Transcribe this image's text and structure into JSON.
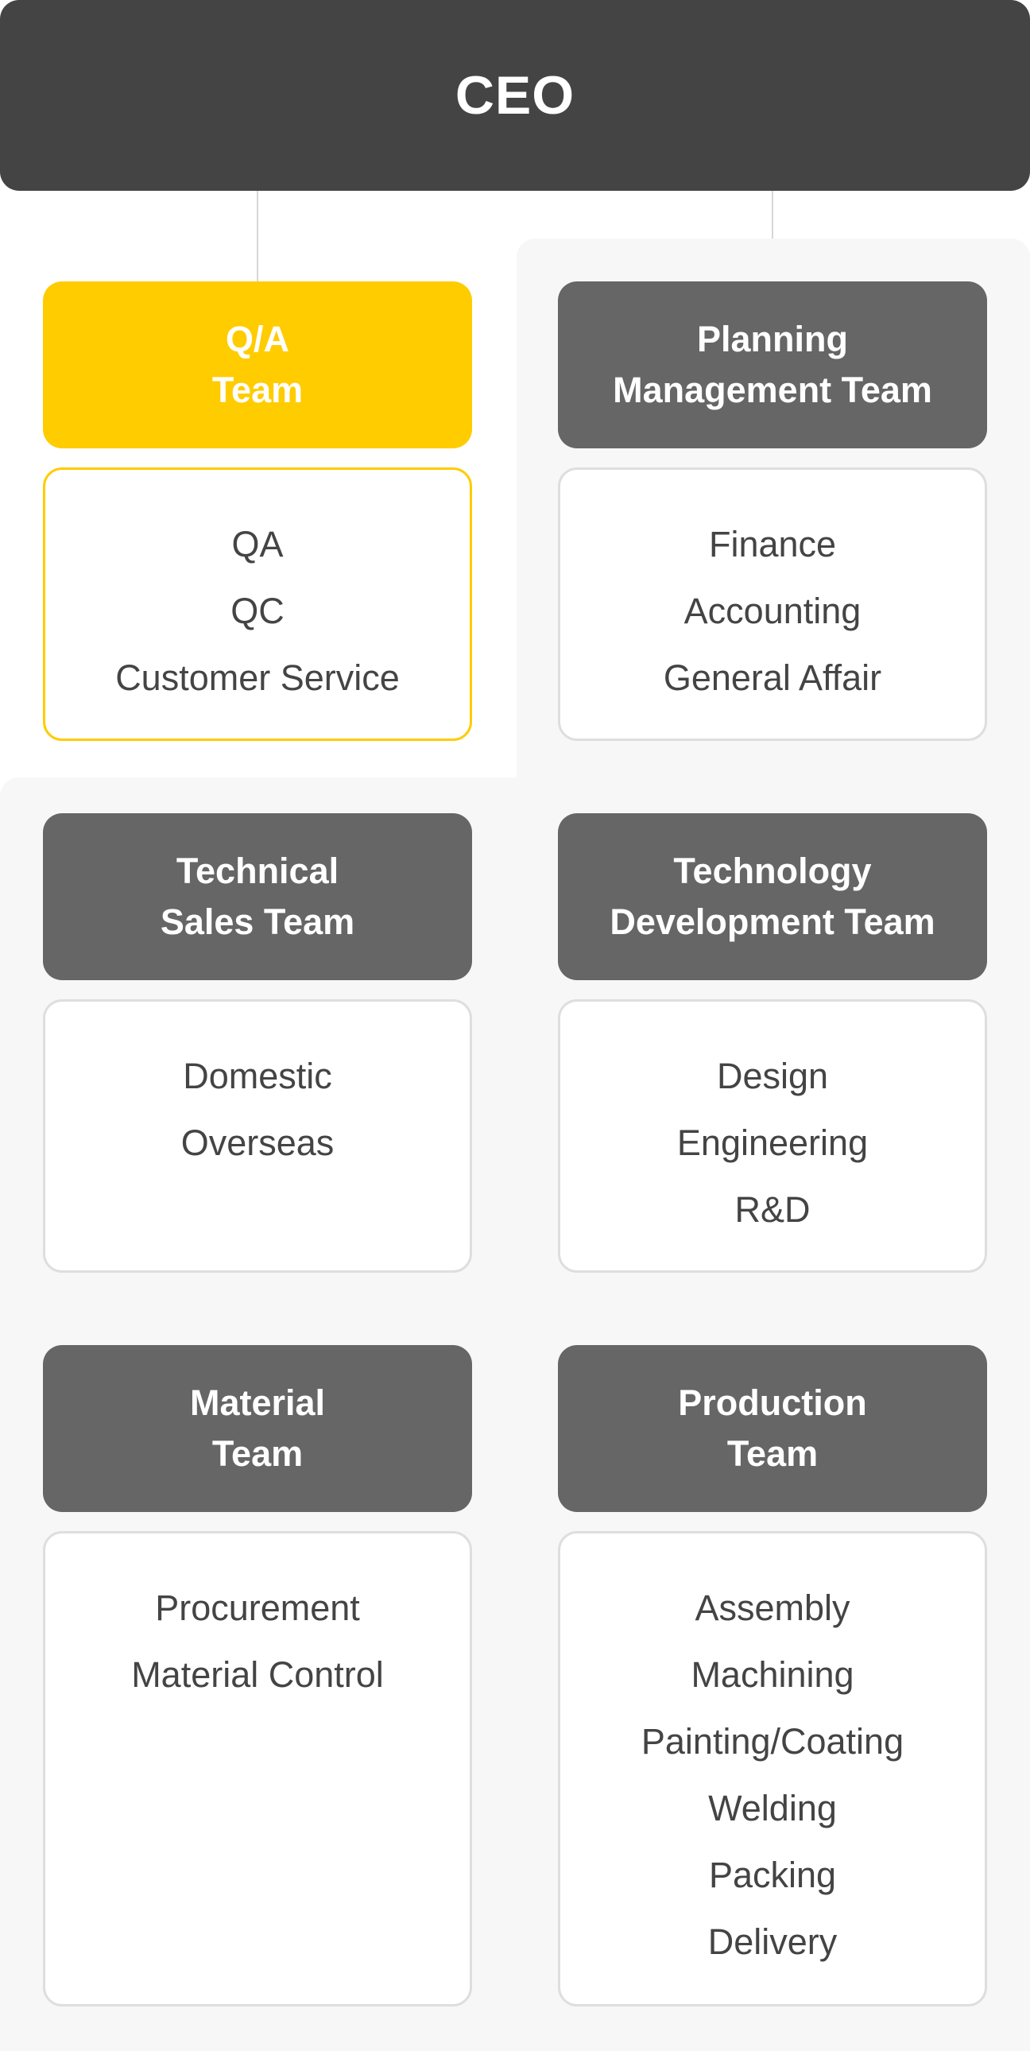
{
  "colors": {
    "ceo_bg": "#444444",
    "team_header_bg": "#666666",
    "highlight": "#ffcc00",
    "panel_bg": "#f7f7f7",
    "body_border": "#dedede",
    "text_dark": "#444444"
  },
  "ceo": {
    "label": "CEO"
  },
  "teams": [
    {
      "title_line1": "Q/A",
      "title_line2": "Team",
      "highlighted": true,
      "functions": [
        "QA",
        "QC",
        "Customer Service"
      ]
    },
    {
      "title_line1": "Planning",
      "title_line2": "Management Team",
      "highlighted": false,
      "functions": [
        "Finance",
        "Accounting",
        "General Affair"
      ]
    },
    {
      "title_line1": "Technical",
      "title_line2": "Sales Team",
      "highlighted": false,
      "functions": [
        "Domestic",
        "Overseas"
      ]
    },
    {
      "title_line1": "Technology",
      "title_line2": "Development Team",
      "highlighted": false,
      "functions": [
        "Design",
        "Engineering",
        "R&D"
      ]
    },
    {
      "title_line1": "Material",
      "title_line2": "Team",
      "highlighted": false,
      "functions": [
        "Procurement",
        "Material Control"
      ]
    },
    {
      "title_line1": "Production",
      "title_line2": "Team",
      "highlighted": false,
      "functions": [
        "Assembly",
        "Machining",
        "Painting/Coating",
        "Welding",
        "Packing",
        "Delivery"
      ]
    }
  ]
}
